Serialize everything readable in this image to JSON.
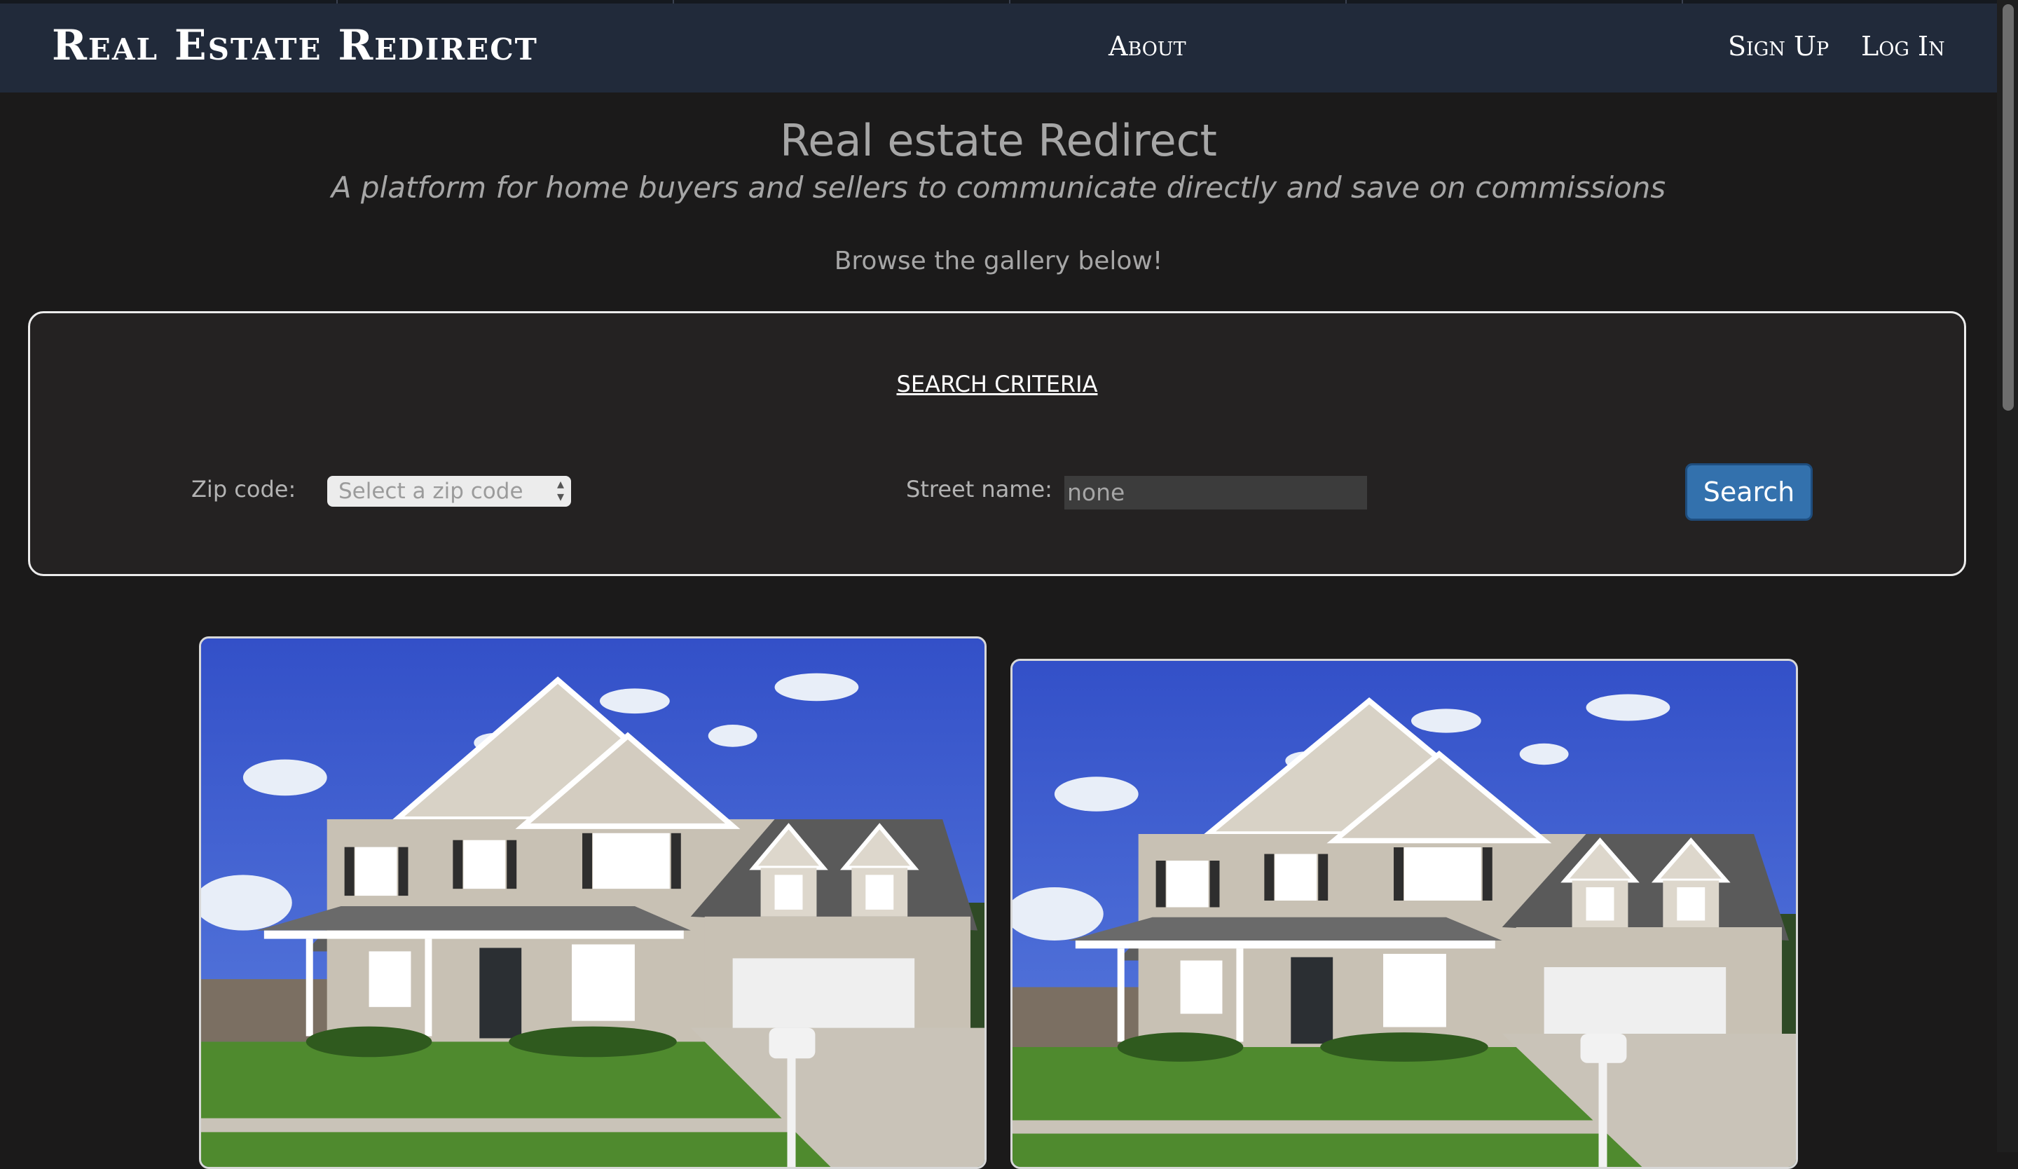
{
  "navbar": {
    "brand": "Real Estate Redirect",
    "links": [
      "About",
      "Sign Up",
      "Log In"
    ]
  },
  "hero": {
    "title": "Real estate Redirect",
    "subtitle": "A platform for home buyers and sellers to communicate directly and save on commissions",
    "browse": "Browse the gallery below!"
  },
  "search": {
    "heading": "SEARCH CRITERIA",
    "zip_label": "Zip code:",
    "zip_selected": "Select a zip code",
    "street_label": "Street name:",
    "street_value": "none",
    "button_label": "Search"
  },
  "gallery": {
    "items": [
      {
        "icon": "house-photo"
      },
      {
        "icon": "house-photo"
      }
    ]
  },
  "colors": {
    "navbar": "#212a3a",
    "background": "#1b1a1a",
    "search_button": "#3371ad",
    "panel_border": "#ececec"
  }
}
